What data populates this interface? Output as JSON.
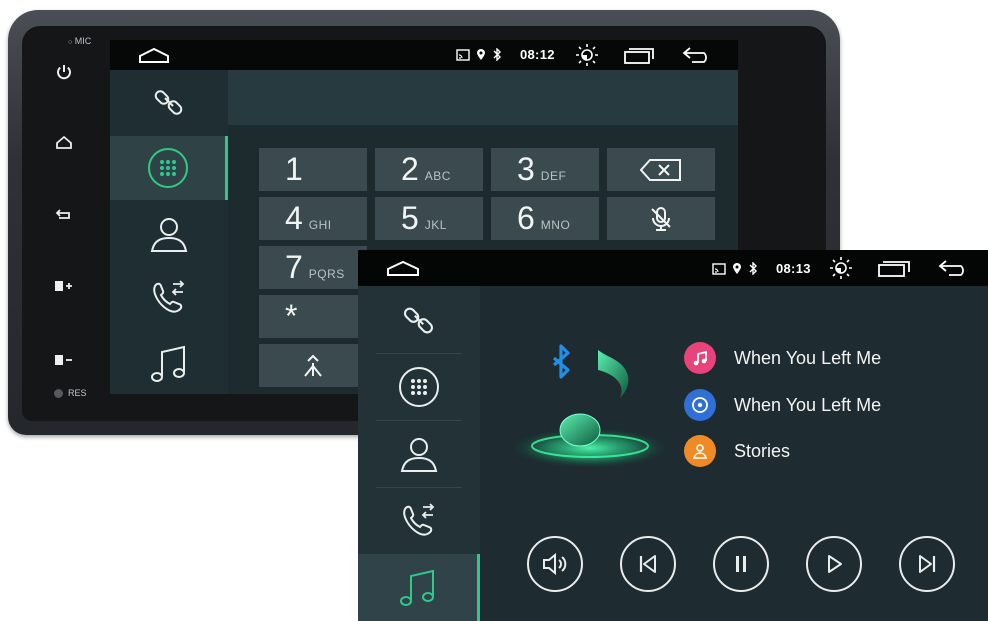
{
  "device": {
    "mic_label": "MIC",
    "res_label": "RES"
  },
  "phone_screen": {
    "status": {
      "time": "08:12"
    },
    "keypad": [
      {
        "num": "1",
        "sub": ""
      },
      {
        "num": "2",
        "sub": "ABC"
      },
      {
        "num": "3",
        "sub": "DEF"
      },
      {
        "num": "4",
        "sub": "GHI"
      },
      {
        "num": "5",
        "sub": "JKL"
      },
      {
        "num": "6",
        "sub": "MNO"
      },
      {
        "num": "7",
        "sub": "PQRS"
      },
      {
        "num": "*",
        "sub": ""
      }
    ]
  },
  "music_screen": {
    "status": {
      "time": "08:13"
    },
    "tracks": [
      {
        "title": "When You Left Me",
        "color": "#e8437a"
      },
      {
        "title": "When You Left Me",
        "color": "#2f6fd6"
      },
      {
        "title": "Stories",
        "color": "#f08a25"
      }
    ],
    "accent_color": "#2fc98b"
  }
}
